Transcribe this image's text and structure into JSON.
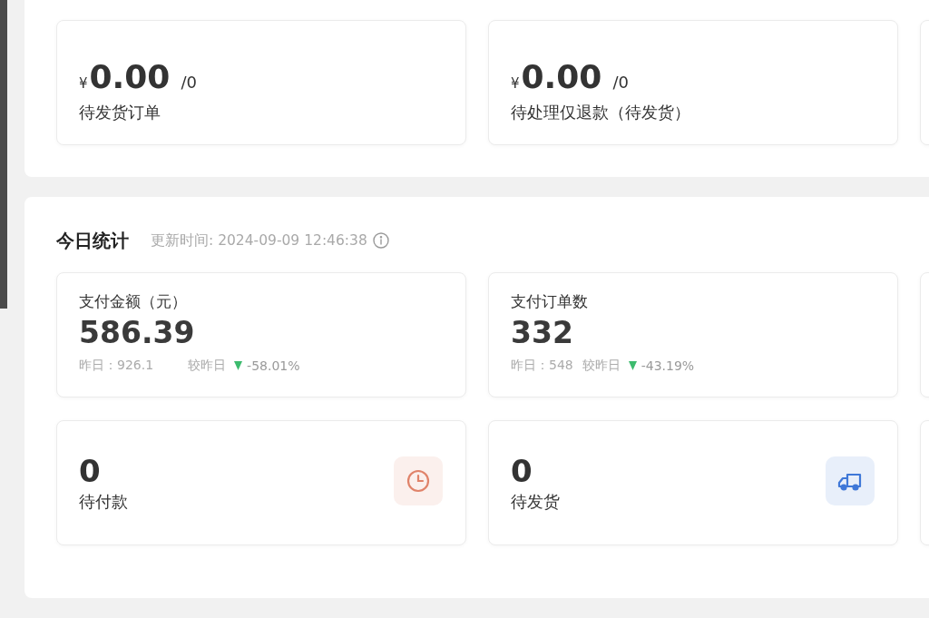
{
  "pending_panel": {
    "cards": [
      {
        "currency": "¥",
        "amount": "0.00",
        "count": "/0",
        "label": "待发货订单"
      },
      {
        "currency": "¥",
        "amount": "0.00",
        "count": "/0",
        "label": "待处理仅退款（待发货）"
      }
    ]
  },
  "today_stats": {
    "title": "今日统计",
    "updated": "更新时间: 2024-09-09 12:46:38",
    "metrics": [
      {
        "label": "支付金额（元）",
        "value": "586.39",
        "yesterday": "昨日：926.1",
        "compare_label": "较昨日",
        "decreased": true,
        "change": "-58.01%"
      },
      {
        "label": "支付订单数",
        "value": "332",
        "yesterday": "昨日：548",
        "compare_label": "较昨日",
        "decreased": true,
        "change": "-43.19%"
      }
    ],
    "counters": [
      {
        "value": "0",
        "label": "待付款",
        "color": "#e0836a"
      },
      {
        "value": "0",
        "label": "待发货",
        "color": "#3f78d8"
      }
    ]
  }
}
